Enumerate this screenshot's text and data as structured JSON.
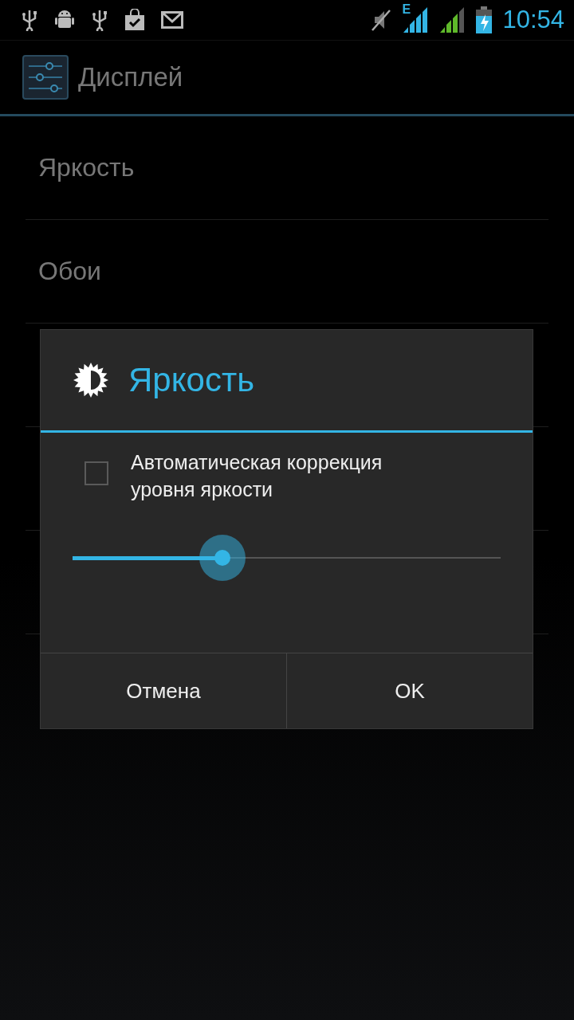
{
  "status_bar": {
    "network_type": "E",
    "time": "10:54"
  },
  "action_bar": {
    "title": "Дисплей"
  },
  "list": [
    {
      "title": "Яркость"
    },
    {
      "title": "Обои"
    }
  ],
  "dialog": {
    "title": "Яркость",
    "auto_brightness": {
      "label": "Автоматическая коррекция уровня яркости",
      "checked": false
    },
    "slider": {
      "level": 0.35
    },
    "buttons": [
      "Отмена",
      "OK"
    ]
  }
}
